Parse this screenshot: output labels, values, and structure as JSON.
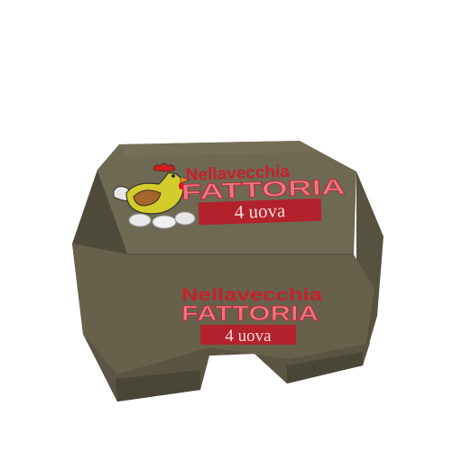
{
  "product": {
    "brand_line1": "Nellavecchia",
    "brand_line2": "FATTORIA",
    "quantity_label": "4 uova"
  },
  "colors": {
    "background": "#ffffff",
    "box_top": "#6f6a54",
    "box_front": "#6a6450",
    "box_side_dark": "#4e4a3a",
    "brand_red": "#c8202c",
    "brand_pink": "#e57b86",
    "label_bg": "#b3222c",
    "label_text": "#f5d9dc",
    "hen_yellow": "#d8cf2a",
    "hen_wing": "#a8682a",
    "hen_comb": "#d81a1a",
    "egg_white": "#ececec"
  },
  "icons": {
    "mascot": "hen-icon",
    "eggs": "eggs-icon"
  }
}
